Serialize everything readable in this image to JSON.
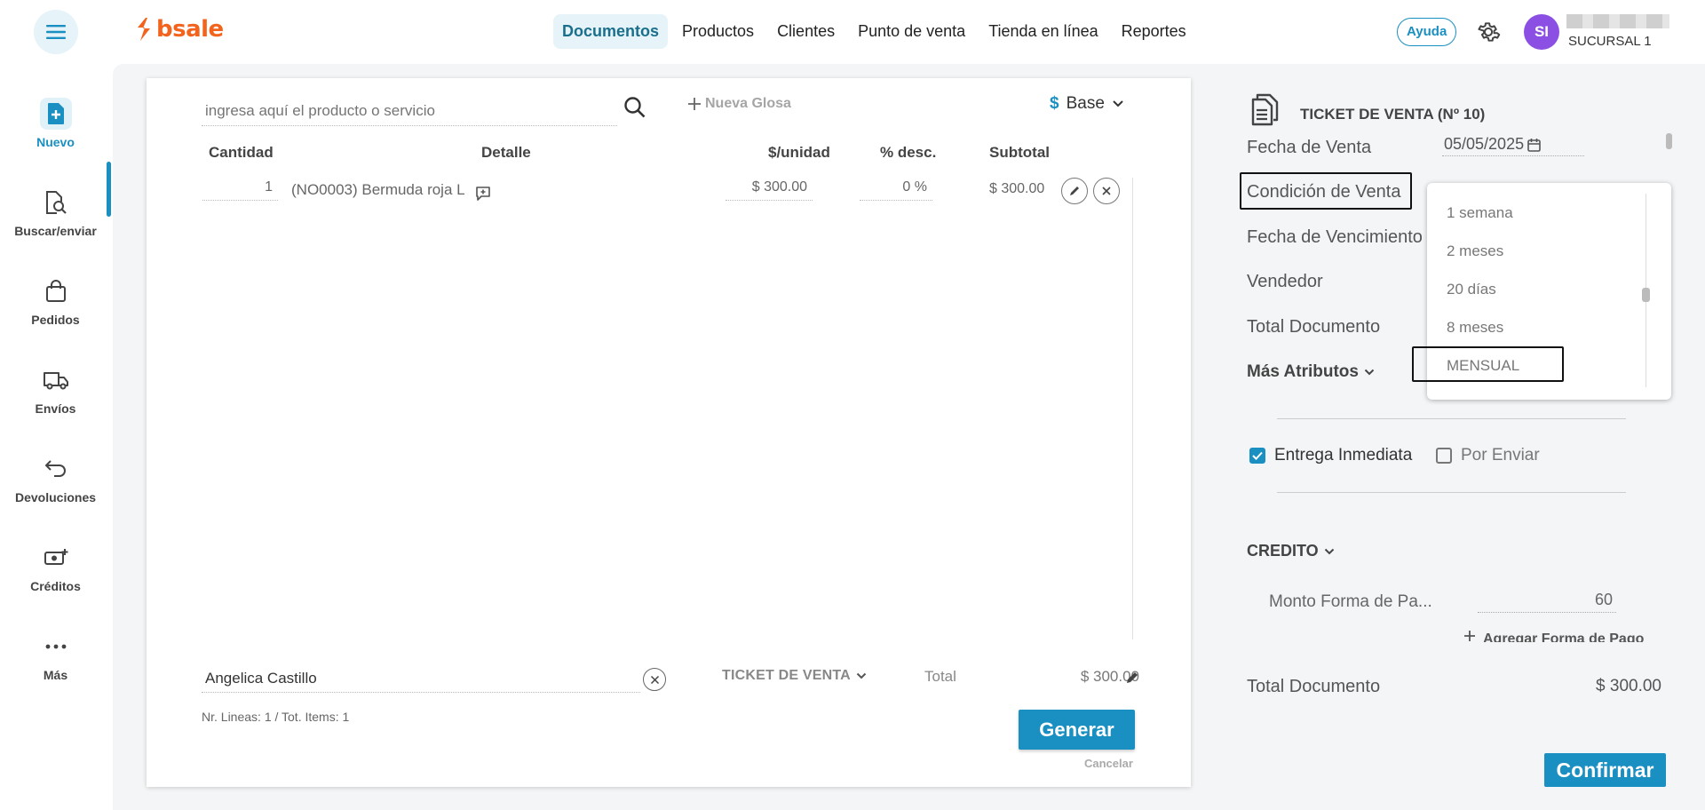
{
  "header": {
    "logo": "bsale",
    "nav": [
      "Documentos",
      "Productos",
      "Clientes",
      "Punto de venta",
      "Tienda en línea",
      "Reportes"
    ],
    "active_nav": "Documentos",
    "help": "Ayuda",
    "avatar_initials": "SI",
    "branch": "SUCURSAL 1"
  },
  "sidebar": {
    "items": [
      {
        "label": "Nuevo",
        "icon": "new-document-icon"
      },
      {
        "label": "Buscar/enviar",
        "icon": "search-document-icon"
      },
      {
        "label": "Pedidos",
        "icon": "shopping-bag-icon"
      },
      {
        "label": "Envíos",
        "icon": "truck-icon"
      },
      {
        "label": "Devoluciones",
        "icon": "return-arrow-icon"
      },
      {
        "label": "Créditos",
        "icon": "money-plus-icon"
      },
      {
        "label": "Más",
        "icon": "more-dots-icon"
      }
    ]
  },
  "document": {
    "search_placeholder": "ingresa aquí el producto o servicio",
    "new_glosa": "Nueva Glosa",
    "price_list_symbol": "$",
    "price_list": "Base",
    "columns": {
      "quantity": "Cantidad",
      "detail": "Detalle",
      "unit_price": "$/unidad",
      "discount": "% desc.",
      "subtotal": "Subtotal"
    },
    "rows": [
      {
        "quantity": "1",
        "detail": "(NO0003) Bermuda roja L",
        "unit_price": "$ 300.00",
        "discount": "0 %",
        "subtotal": "$ 300.00"
      }
    ],
    "client": "Angelica Castillo",
    "doc_type": "TICKET DE VENTA",
    "total_label": "Total",
    "total_value": "$ 300.00",
    "lines_info": "Nr. Lineas: 1 / Tot. Items: 1",
    "generate": "Generar",
    "cancel": "Cancelar"
  },
  "panel": {
    "title": "TICKET DE VENTA (Nº 10)",
    "sale_date_label": "Fecha de Venta",
    "sale_date": "05/05/2025",
    "sale_condition_label": "Condición de Venta",
    "due_date_label": "Fecha de Vencimiento",
    "seller_label": "Vendedor",
    "total_doc_label": "Total Documento",
    "more_attributes": "Más Atributos",
    "immediate_delivery": "Entrega Inmediata",
    "immediate_delivery_checked": true,
    "to_ship": "Por Enviar",
    "to_ship_checked": false,
    "payment_section": "CREDITO",
    "payment_amount_label": "Monto Forma de Pa...",
    "payment_amount": "60",
    "add_payment": "Agregar Forma de Pago",
    "total_document_label": "Total Documento",
    "total_document_value": "$ 300.00",
    "confirm": "Confirmar"
  },
  "dropdown": {
    "options": [
      "1 semana",
      "2 meses",
      "20 días",
      "8 meses",
      "MENSUAL"
    ],
    "selected": "MENSUAL"
  },
  "colors": {
    "accent": "#1a8fc2",
    "brand": "#f2641e",
    "avatar": "#8b4fe3",
    "nav_active_bg": "#e6f3f8"
  }
}
